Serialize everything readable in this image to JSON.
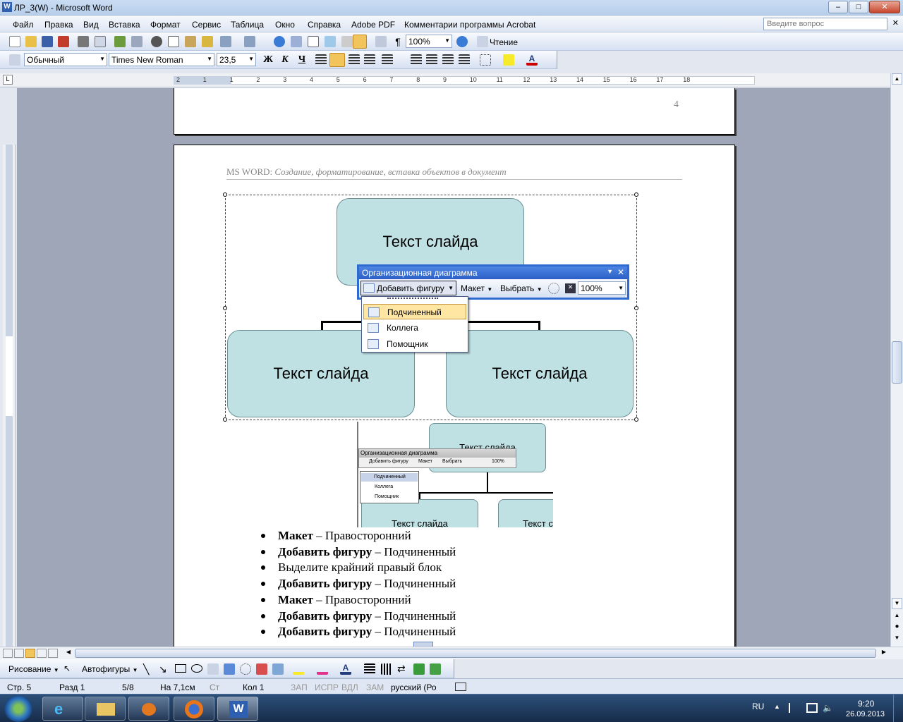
{
  "window": {
    "title": "ЛР_3(W) - Microsoft Word",
    "minimize": "–",
    "maximize": "□",
    "close": "✕"
  },
  "menu": {
    "items": [
      "Файл",
      "Правка",
      "Вид",
      "Вставка",
      "Формат",
      "Сервис",
      "Таблица",
      "Окно",
      "Справка",
      "Adobe PDF",
      "Комментарии программы Acrobat"
    ],
    "ask_placeholder": "Введите вопрос"
  },
  "toolbar_standard": {
    "zoom": "100%",
    "reading": "Чтение"
  },
  "toolbar_format": {
    "style": "Обычный",
    "font": "Times New Roman",
    "size": "23,5",
    "bold": "Ж",
    "italic": "К",
    "underline": "Ч"
  },
  "ruler": {
    "h_ticks": [
      "2",
      "1",
      "1",
      "2",
      "3",
      "4",
      "5",
      "6",
      "7",
      "8",
      "9",
      "10",
      "11",
      "12",
      "13",
      "14",
      "15",
      "16",
      "17",
      "18"
    ]
  },
  "page1": {
    "page_number": "4"
  },
  "page2": {
    "header_prefix": "MS WORD: ",
    "header_text": "Создание, форматирование, вставка объектов в документ",
    "diagram": {
      "top_box": "Текст слайда",
      "left_box": "Текст слайда",
      "right_box": "Текст слайда"
    },
    "org_toolbar": {
      "title": "Организационная диаграмма",
      "add_shape": "Добавить фигуру",
      "layout": "Макет",
      "select": "Выбрать",
      "zoom": "100%"
    },
    "add_shape_menu": [
      "Подчиненный",
      "Коллега",
      "Помощник"
    ],
    "thumbnail": {
      "top_box": "Текст слайда",
      "toolbar_title": "Организационная диаграмма",
      "add_shape": "Добавить фигуру",
      "layout": "Макет",
      "select": "Выбрать",
      "zoom": "100%",
      "menu": [
        "Подчиненный",
        "Коллега",
        "Помощник"
      ],
      "left_box": "Текст слайда",
      "right_box": "Текст с"
    },
    "bullets": [
      {
        "bold": "Макет",
        "rest": " – Правосторонний"
      },
      {
        "bold": "Добавить фигуру",
        "rest": " – Подчиненный"
      },
      {
        "bold": "",
        "rest": "Выделите крайний правый блок"
      },
      {
        "bold": "Добавить фигуру",
        "rest": " – Подчиненный"
      },
      {
        "bold": "Макет",
        "rest": " – Правосторонний"
      },
      {
        "bold": "Добавить фигуру",
        "rest": " – Подчиненный"
      },
      {
        "bold": "Добавить фигуру",
        "rest": " – Подчиненный"
      }
    ]
  },
  "drawing_toolbar": {
    "drawing": "Рисование",
    "autoshapes": "Автофигуры"
  },
  "status_bar": {
    "page": "Стр. 5",
    "section": "Разд 1",
    "pages": "5/8",
    "at": "На 7,1см",
    "line": "Ст",
    "col": "Кол 1",
    "rec": "ЗАП",
    "trk": "ИСПР",
    "ext": "ВДЛ",
    "ovr": "ЗАМ",
    "lang": "русский (Ро"
  },
  "taskbar": {
    "lang": "RU",
    "time": "9:20",
    "date": "26.09.2013"
  },
  "colors": {
    "accent": "#2f6ad0",
    "box_fill": "#bfe1e4",
    "highlight": "#ffe6a3"
  }
}
